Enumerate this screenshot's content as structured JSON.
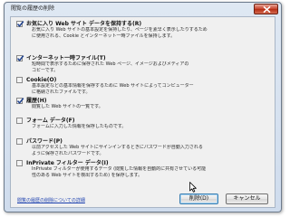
{
  "dialog": {
    "title": "閲覧の履歴の削除"
  },
  "options": [
    {
      "title": "お気に入り Web サイト データを保持する(R)",
      "checked": true,
      "desc": [
        "お気に入り Web サイトの基本設定を保持したり、ページを素早く表示したりするため",
        "に使用される、Cookie とインターネット一時ファイルを保持します。"
      ]
    },
    {
      "title": "インターネット一時ファイル(T)",
      "checked": true,
      "desc": [
        "短時間で表示するために保存された Web ページ、イメージおよびメディアの",
        "コピーです。"
      ]
    },
    {
      "title": "Cookie(O)",
      "checked": false,
      "desc": [
        "基本設定などの基本情報を保存するために Web サイトによってコンピューター",
        "に格納されたファイルです。"
      ]
    },
    {
      "title": "履歴(H)",
      "checked": true,
      "desc": [
        "閲覧した Web サイトの一覧です。"
      ]
    },
    {
      "title": "フォーム データ(F)",
      "checked": false,
      "desc": [
        "フォームに入力した情報を保存したものです。"
      ]
    },
    {
      "title": "パスワード(P)",
      "checked": false,
      "desc": [
        "以前アクセスした Web サイトにサインインするときにパスワードが自動入力される",
        "ように保存されたパスワードです。"
      ]
    },
    {
      "title": "InPrivate フィルター データ(I)",
      "checked": false,
      "desc": [
        "InPrivate フィルターが使用するデータ (閲覧した情報を自動的に共有させている可能",
        "性のある Web サイトを検出するため) を保存します。"
      ]
    }
  ],
  "footer": {
    "help_link": "閲覧の履歴の削除についての詳細",
    "delete_label": "削除(D)",
    "cancel_label": "キャンセル"
  }
}
